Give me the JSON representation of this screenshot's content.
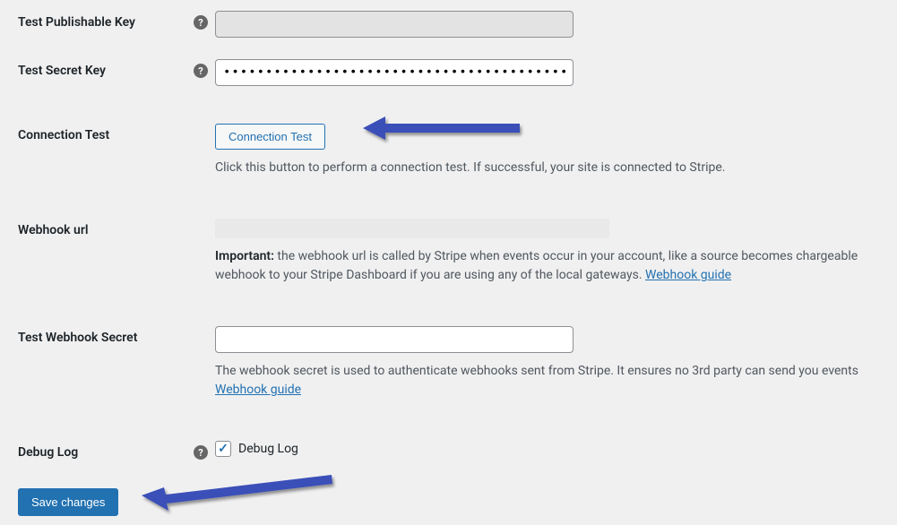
{
  "fields": {
    "testPublishableKey": {
      "label": "Test Publishable Key",
      "value": ""
    },
    "testSecretKey": {
      "label": "Test Secret Key",
      "value": "•••••••••••••••••••••••••••••••••••••••••••••••••••••••••••••••"
    },
    "connectionTest": {
      "label": "Connection Test",
      "buttonLabel": "Connection Test",
      "description": "Click this button to perform a connection test. If successful, your site is connected to Stripe."
    },
    "webhookUrl": {
      "label": "Webhook url",
      "importantLabel": "Important:",
      "description1": " the webhook url is called by Stripe when events occur in your account, like a source becomes chargeable",
      "description2": " webhook to your Stripe Dashboard if you are using any of the local gateways. ",
      "linkText": "Webhook guide"
    },
    "testWebhookSecret": {
      "label": "Test Webhook Secret",
      "value": "",
      "description": "The webhook secret is used to authenticate webhooks sent from Stripe. It ensures no 3rd party can send you events",
      "linkText": "Webhook guide"
    },
    "debugLog": {
      "label": "Debug Log",
      "checkboxLabel": "Debug Log",
      "checked": true
    }
  },
  "saveButton": "Save changes"
}
